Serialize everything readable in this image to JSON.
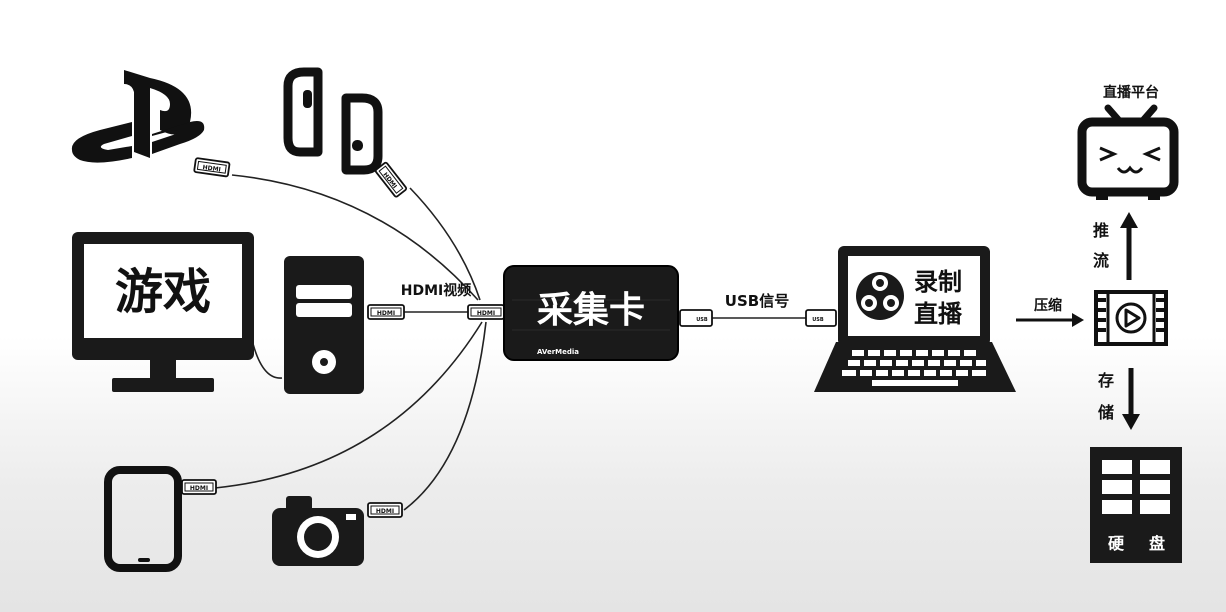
{
  "devices": {
    "pc_monitor_text": "游戏"
  },
  "connections": {
    "hdmi_video_label": "HDMI视频",
    "usb_signal_label": "USB信号",
    "hdmi_plug_text": "HDMI",
    "usb_plug_text": "USB"
  },
  "capture_card": {
    "label": "采集卡",
    "brand": "AVerMedia"
  },
  "laptop": {
    "line1": "录制",
    "line2": "直播"
  },
  "flow": {
    "compress_label": "压缩",
    "push_stream_label_1": "推",
    "push_stream_label_2": "流",
    "store_label_1": "存",
    "store_label_2": "储"
  },
  "outputs": {
    "live_platform_label": "直播平台",
    "hard_disk_label_1": "硬",
    "hard_disk_label_2": "盘"
  },
  "colors": {
    "ink": "#111111",
    "card_bg": "#1a1a1a",
    "background": "#ffffff"
  }
}
